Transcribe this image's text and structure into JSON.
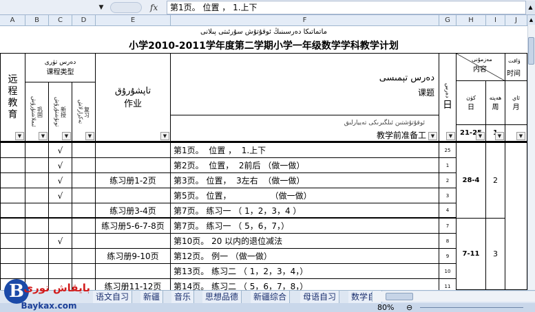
{
  "formula_bar": {
    "name_box_arrow": "▼",
    "fx": "fx",
    "content": "第1页。  位置 ，  1.上下",
    "expand": "▲"
  },
  "columns": [
    "A",
    "B",
    "C",
    "D",
    "E",
    "F",
    "G",
    "H",
    "I",
    "J"
  ],
  "sheet": {
    "uyghur_header": "ماتماتىكا دەرسىنىڭ ئوقۇتۇش سۇرئىتى پىلانى",
    "title": "小学2010-2011学年度第二学期小学一年级数学学科教学计划",
    "header": {
      "remote_edu": "远程教育",
      "course_type_ug": "دەرس تۈرى",
      "course_type": "课程类型",
      "sub_a": "ئىملاشتۇرۇش",
      "sub_a_cn": "巩固",
      "sub_b": "تونۇشتۇرۇش",
      "sub_b_cn": "新授",
      "sub_c": "تەكرارلاش",
      "sub_c_cn": "复习",
      "homework_ug": "تاپشۇرۇق",
      "homework": "作业",
      "topic_ug": "دەرس تېمىسى",
      "topic": "课题",
      "preprep_ug": "ئوقۇتۇشتىن ئىلگىرىكى تەييارلىق",
      "preprep": "教学前准备工",
      "lesson_num_ug": "دەرس",
      "day_ug": "كۈن",
      "day": "日",
      "content_ug": "مەزمۇنى",
      "content": "内容",
      "time_ug": "ۋاقت",
      "time": "时间",
      "h_day_ug": "كۈن",
      "h_day": "日",
      "week_ug": "ھەپتە",
      "week": "周",
      "month_ug": "ئاي",
      "month": "月",
      "partial_date": "21-25",
      "partial_week": "1"
    },
    "rows": [
      {
        "c": "√",
        "e": "",
        "f": "第1页。  位置 ，  1.上下",
        "g": "25"
      },
      {
        "c": "√",
        "e": "",
        "f": "第2页。  位置，  2前后 （做一做）",
        "g": "1"
      },
      {
        "c": "√",
        "e": "练习册1-2页",
        "f": "第3页。 位置，  3左右  （做一做）",
        "g": "2"
      },
      {
        "c": "√",
        "e": "",
        "f": "第5页。 位置，               （做一做）",
        "g": "3"
      },
      {
        "c": "",
        "e": "练习册3-4页",
        "f": "第7页。 练习一 （ 1，2，3，4 ）",
        "g": "4"
      },
      {
        "c": "",
        "e": "练习册5-6-7-8页",
        "f": "第7页。 练习一 （ 5，6，7，）",
        "g": "7"
      },
      {
        "c": "√",
        "e": "",
        "f": "第10页。 20 以内的退位减法",
        "g": "8"
      },
      {
        "c": "",
        "e": "练习册9-10页",
        "f": "第12页。 例一 （做一做）",
        "g": "9"
      },
      {
        "c": "",
        "e": "",
        "f": "第13页。 练习二 （ 1，2，3，4，）",
        "g": "10"
      },
      {
        "c": "",
        "e": "练习册11-12页",
        "f": "第14页。 练习二 （ 5，6，7，8，）",
        "g": "11"
      }
    ],
    "merged": {
      "date_1": "28-4",
      "week_1": "2",
      "date_2": "7-11",
      "week_2": "3"
    },
    "filter_arrow": "▼"
  },
  "tabs": [
    "语文自习",
    "新疆",
    "音乐",
    "思想品德",
    "新疆综合",
    "母语自习",
    "数学自"
  ],
  "status": {
    "zoom": "80%",
    "minus": "⊖"
  },
  "logo": {
    "letter": "B",
    "uyghur": "بايقاش تورى",
    "url": "Baykax.com"
  },
  "colors": {
    "grid": "#000000",
    "header_bg": "#e4ecf7",
    "logo_red": "#d21c1c",
    "logo_blue": "#1b4aa8"
  }
}
